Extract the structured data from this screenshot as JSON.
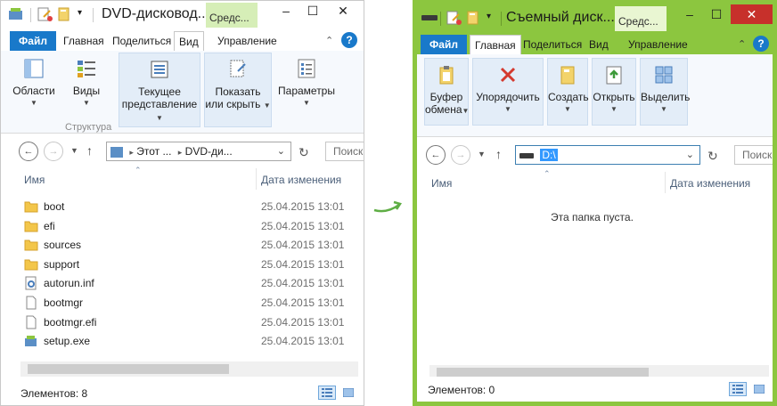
{
  "window1": {
    "title": "DVD-дисковод...",
    "context_tab": "Средс...",
    "tabs": {
      "file": "Файл",
      "home": "Главная",
      "share": "Поделиться",
      "view": "Вид",
      "manage": "Управление"
    },
    "ribbon": {
      "areas": "Области",
      "views": "Виды",
      "current_view_1": "Текущее",
      "current_view_2": "представление",
      "show_hide_1": "Показать",
      "show_hide_2": "или скрыть",
      "options": "Параметры",
      "group_structure": "Структура"
    },
    "address": {
      "part1": "Этот ...",
      "part2": "DVD-ди..."
    },
    "search_placeholder": "Поиск",
    "columns": {
      "name": "Имя",
      "date": "Дата изменения"
    },
    "files": [
      {
        "name": "boot",
        "date": "25.04.2015 13:01",
        "icon": "folder-icon"
      },
      {
        "name": "efi",
        "date": "25.04.2015 13:01",
        "icon": "folder-icon"
      },
      {
        "name": "sources",
        "date": "25.04.2015 13:01",
        "icon": "folder-icon"
      },
      {
        "name": "support",
        "date": "25.04.2015 13:01",
        "icon": "folder-icon"
      },
      {
        "name": "autorun.inf",
        "date": "25.04.2015 13:01",
        "icon": "settings-file-icon"
      },
      {
        "name": "bootmgr",
        "date": "25.04.2015 13:01",
        "icon": "file-icon"
      },
      {
        "name": "bootmgr.efi",
        "date": "25.04.2015 13:01",
        "icon": "file-icon"
      },
      {
        "name": "setup.exe",
        "date": "25.04.2015 13:01",
        "icon": "setup-exe-icon"
      }
    ],
    "status": "Элементов: 8"
  },
  "window2": {
    "title": "Съемный диск...",
    "context_tab": "Средс...",
    "tabs": {
      "file": "Файл",
      "home": "Главная",
      "share": "Поделиться",
      "view": "Вид",
      "manage": "Управление"
    },
    "ribbon": {
      "clipboard_1": "Буфер",
      "clipboard_2": "обмена",
      "organize": "Упорядочить",
      "new": "Создать",
      "open": "Открыть",
      "select": "Выделить"
    },
    "address": {
      "path": "D:\\"
    },
    "search_placeholder": "Поиск",
    "columns": {
      "name": "Имя",
      "date": "Дата изменения"
    },
    "empty_message": "Эта папка пуста.",
    "status": "Элементов: 0"
  },
  "colors": {
    "win2_frame": "#8cc63f",
    "file_tab": "#1979ca",
    "arrow": "#5fae45",
    "selection": "#3399ff"
  }
}
